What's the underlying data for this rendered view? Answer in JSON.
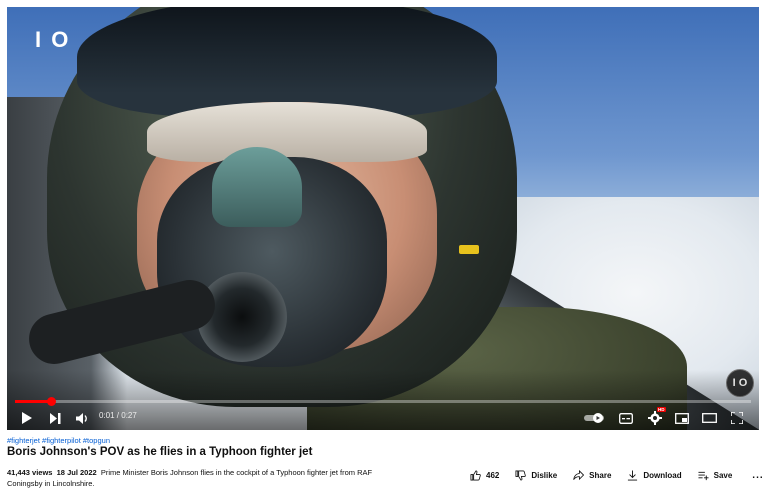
{
  "player": {
    "channel_logo": "I O",
    "watermark": "I O",
    "time_display": "0:01 / 0:27",
    "progress_fraction": 0.05,
    "controls": [
      "play-icon",
      "next-icon",
      "volume-icon",
      "autoplay-toggle",
      "subtitles-icon",
      "settings-icon",
      "miniplayer-icon",
      "theater-icon",
      "fullscreen-icon"
    ],
    "settings_badge": "HD"
  },
  "video": {
    "hashtags": "#fighterjet #fighterpilot #topgun",
    "title": "Boris Johnson's POV as he flies in a Typhoon fighter jet",
    "views": "41,443 views",
    "date": "18 Jul 2022",
    "description": "Prime Minister Boris Johnson flies in the cockpit of a Typhoon fighter jet from RAF Coningsby in Lincolnshire."
  },
  "actions": {
    "likes": "462",
    "dislike_label": "Dislike",
    "share_label": "Share",
    "download_label": "Download",
    "save_label": "Save",
    "more": "..."
  },
  "colors": {
    "accent": "#ff0000",
    "link": "#065fd4"
  }
}
